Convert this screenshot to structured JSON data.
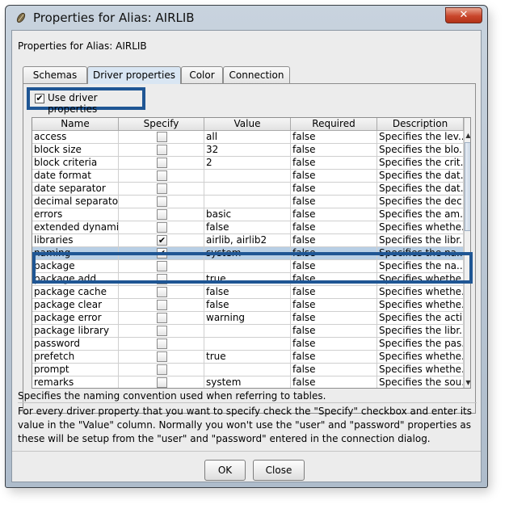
{
  "window": {
    "title": "Properties for Alias: AIRLIB",
    "close_label": "✕"
  },
  "dialog": {
    "label": "Properties for Alias: AIRLIB"
  },
  "tabs": [
    {
      "label": "Schemas",
      "active": false
    },
    {
      "label": "Driver properties",
      "active": true
    },
    {
      "label": "Color",
      "active": false
    },
    {
      "label": "Connection",
      "active": false
    }
  ],
  "use_driver_properties": {
    "label": "Use driver properties",
    "checked": true
  },
  "table": {
    "columns": [
      "Name",
      "Specify",
      "Value",
      "Required",
      "Description"
    ],
    "rows": [
      {
        "name": "access",
        "specify": false,
        "value": "all",
        "required": "false",
        "description": "Specifies the lev..."
      },
      {
        "name": "block size",
        "specify": false,
        "value": "32",
        "required": "false",
        "description": "Specifies the blo..."
      },
      {
        "name": "block criteria",
        "specify": false,
        "value": "2",
        "required": "false",
        "description": "Specifies the crit..."
      },
      {
        "name": "date format",
        "specify": false,
        "value": "",
        "required": "false",
        "description": "Specifies the dat..."
      },
      {
        "name": "date separator",
        "specify": false,
        "value": "",
        "required": "false",
        "description": "Specifies the dat..."
      },
      {
        "name": "decimal separator",
        "specify": false,
        "value": "",
        "required": "false",
        "description": "Specifies the dec..."
      },
      {
        "name": "errors",
        "specify": false,
        "value": "basic",
        "required": "false",
        "description": "Specifies the am..."
      },
      {
        "name": "extended dynamic",
        "specify": false,
        "value": "false",
        "required": "false",
        "description": "Specifies whethe..."
      },
      {
        "name": "libraries",
        "specify": true,
        "value": "airlib, airlib2",
        "required": "false",
        "description": "Specifies the libr..."
      },
      {
        "name": "naming",
        "specify": true,
        "value": "system",
        "required": "false",
        "description": "Specifies the na...",
        "selected": true
      },
      {
        "name": "package",
        "specify": false,
        "value": "",
        "required": "false",
        "description": "Specifies the na..."
      },
      {
        "name": "package add",
        "specify": false,
        "value": "true",
        "required": "false",
        "description": "Specifies whethe..."
      },
      {
        "name": "package cache",
        "specify": false,
        "value": "false",
        "required": "false",
        "description": "Specifies whethe..."
      },
      {
        "name": "package clear",
        "specify": false,
        "value": "false",
        "required": "false",
        "description": "Specifies whethe..."
      },
      {
        "name": "package error",
        "specify": false,
        "value": "warning",
        "required": "false",
        "description": "Specifies the acti..."
      },
      {
        "name": "package library",
        "specify": false,
        "value": "",
        "required": "false",
        "description": "Specifies the libr..."
      },
      {
        "name": "password",
        "specify": false,
        "value": "",
        "required": "false",
        "description": "Specifies the pas..."
      },
      {
        "name": "prefetch",
        "specify": false,
        "value": "true",
        "required": "false",
        "description": "Specifies whethe..."
      },
      {
        "name": "prompt",
        "specify": false,
        "value": "",
        "required": "false",
        "description": "Specifies whethe..."
      },
      {
        "name": "remarks",
        "specify": false,
        "value": "system",
        "required": "false",
        "description": "Specifies the sou..."
      },
      {
        "name": "",
        "specify": false,
        "value": "",
        "required": "",
        "description": ""
      }
    ]
  },
  "description_line": "Specifies the naming convention used when referring to tables.",
  "help_text": "For every driver property that you want to specify check the \"Specify\" checkbox and enter its value in the \"Value\" column. Normally you won't use the \"user\" and \"password\" properties as these will be setup from the \"user\" and \"password\" entered in the connection dialog.",
  "buttons": {
    "ok": "OK",
    "close": "Close"
  },
  "colors": {
    "highlight_border": "#1f5694",
    "selected_row": "#b8cfe5"
  },
  "icons": {
    "app": "coffee-bean-icon",
    "scroll_up": "arrow-up-icon",
    "scroll_down": "arrow-down-icon"
  }
}
